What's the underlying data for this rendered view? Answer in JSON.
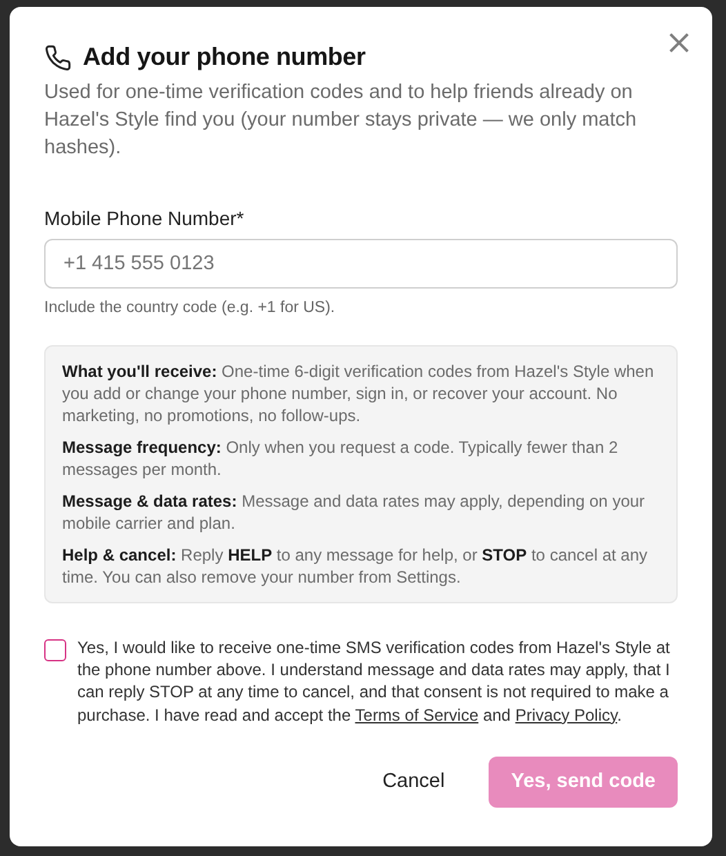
{
  "dialog": {
    "title": "Add your phone number",
    "description": "Used for one-time verification codes and to help friends already on Hazel's Style find you (your number stays private — we only match hashes).",
    "phone_field": {
      "label": "Mobile Phone Number*",
      "placeholder": "+1 415 555 0123",
      "hint": "Include the country code (e.g. +1 for US)."
    },
    "info": [
      {
        "text": "**What you'll receive:** One-time 6-digit verification codes from Hazel's Style when you add or change your phone number, sign in, or recover your account. No marketing, no promotions, no follow-ups."
      },
      {
        "text": "**Message frequency:** Only when you request a code. Typically fewer than 2 messages per month."
      },
      {
        "text": "**Message & data rates:** Message and data rates may apply, depending on your mobile carrier and plan."
      },
      {
        "text": "**Help & cancel:** Reply **HELP** to any message for help, or **STOP** to cancel at any time. You can also remove your number from Settings."
      }
    ],
    "consent": {
      "checked": false,
      "parts": [
        {
          "kind": "text",
          "text": "Yes, I would like to receive one-time SMS verification codes from Hazel's Style at the phone number above. I understand message and data rates may apply, that I can reply STOP at any time to cancel, and that consent is not required to make a purchase. I have read and accept the "
        },
        {
          "kind": "link",
          "text": "Terms of Service"
        },
        {
          "kind": "text",
          "text": " and "
        },
        {
          "kind": "link",
          "text": "Privacy Policy"
        },
        {
          "kind": "text",
          "text": "."
        }
      ]
    },
    "buttons": [
      {
        "kind": "secondary",
        "label": "Cancel",
        "disabled": false
      },
      {
        "kind": "primary",
        "label": "Yes, send code",
        "disabled": true
      }
    ]
  }
}
